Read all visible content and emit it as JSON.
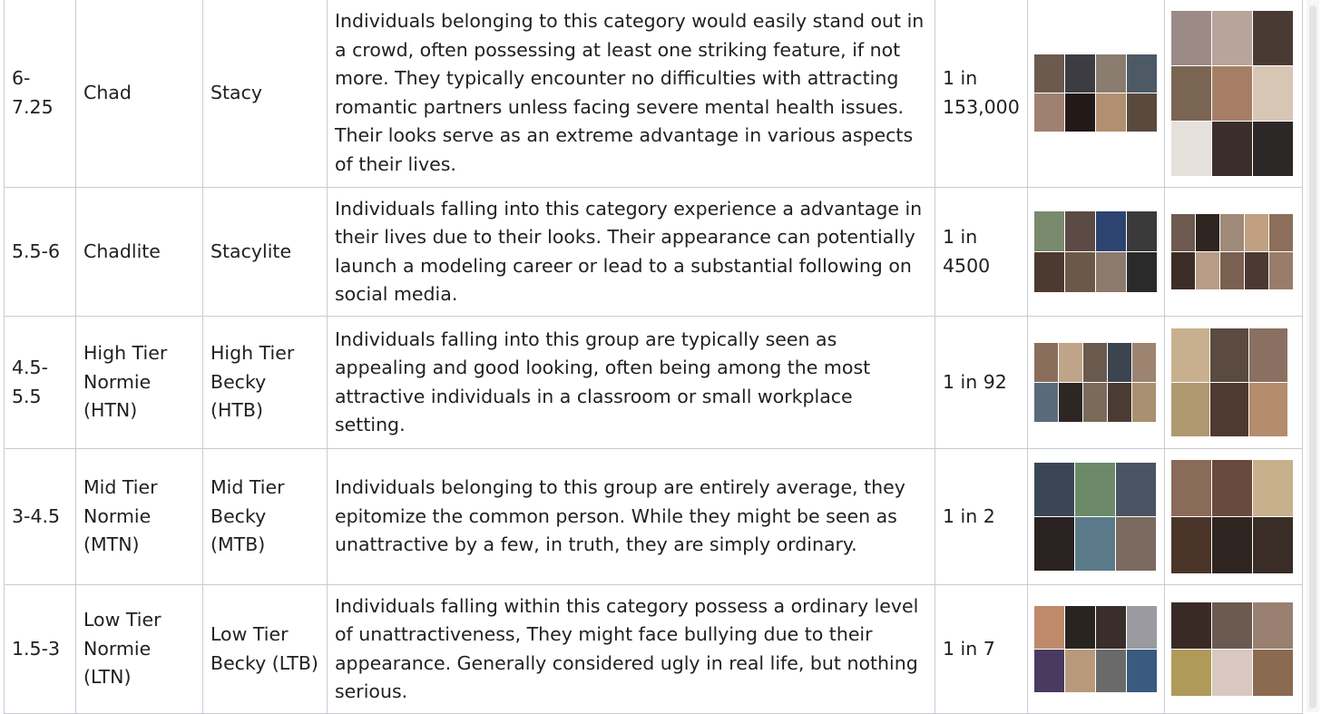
{
  "rows": [
    {
      "score": "6-\n7.25",
      "male": "Chad",
      "female": "Stacy",
      "description": "Individuals belonging to this category would easily stand out in a crowd, often possessing at least one striking feature, if not more. They typically encounter no difficulties with attracting romantic partners unless facing severe mental health issues. Their looks serve as an extreme advantage in various aspects of their lives.",
      "frequency": "1 in\n153,000"
    },
    {
      "score": "5.5-6",
      "male": "Chadlite",
      "female": "Stacylite",
      "description": "Individuals falling into this category experience a advantage in their lives due to their looks. Their appearance can potentially launch a modeling career or lead to a substantial following on social media.",
      "frequency": "1 in\n4500"
    },
    {
      "score": "4.5-\n5.5",
      "male": "High Tier\nNormie\n(HTN)",
      "female": "High Tier\nBecky (HTB)",
      "description": "Individuals falling into this group are typically seen as appealing and good looking, often being among the most attractive individuals in a classroom or small workplace setting.",
      "frequency": "1 in 92"
    },
    {
      "score": "3-4.5",
      "male": "Mid Tier\nNormie\n(MTN)",
      "female": "Mid Tier\nBecky\n(MTB)",
      "description": "Individuals belonging to this group are entirely average, they epitomize the common person. While they might be seen as unattractive by a few, in truth, they are simply ordinary.",
      "frequency": "1 in 2"
    },
    {
      "score": "1.5-3",
      "male": "Low Tier\nNormie\n(LTN)",
      "female": "Low Tier\nBecky (LTB)",
      "description": "Individuals falling within this category possess a ordinary level of unattractiveness, They might face bullying due to their appearance. Generally considered ugly in real life, but nothing serious.",
      "frequency": "1 in 7"
    }
  ]
}
